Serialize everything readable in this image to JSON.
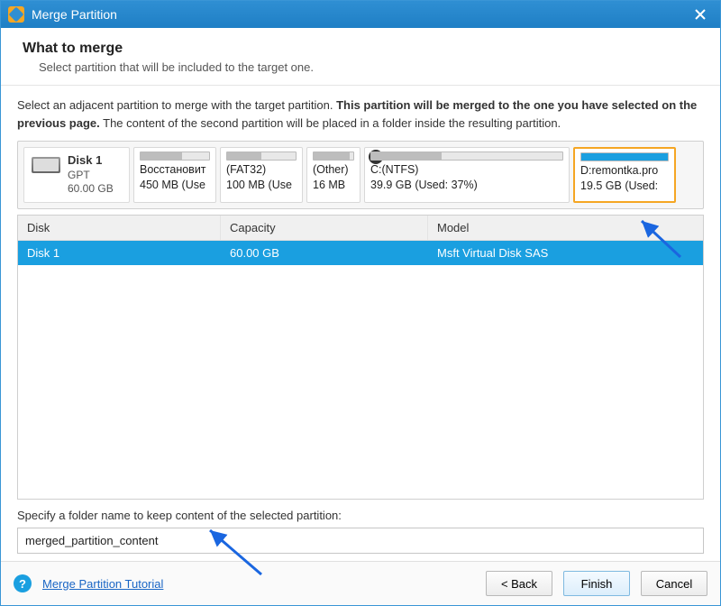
{
  "titlebar": {
    "title": "Merge Partition"
  },
  "header": {
    "heading": "What to merge",
    "sub": "Select partition that will be included to the target one."
  },
  "body": {
    "desc_pre": "Select an adjacent partition to merge with the target partition. ",
    "desc_bold": "This partition will be merged to the one you have selected on the previous page.",
    "desc_post": " The content of the second partition will be placed in a folder inside the resulting partition."
  },
  "disk": {
    "name": "Disk 1",
    "scheme": "GPT",
    "size": "60.00 GB",
    "partitions": [
      {
        "line1": "Восстановит",
        "line2": "450 MB (Use"
      },
      {
        "line1": "(FAT32)",
        "line2": "100 MB (Use"
      },
      {
        "line1": "(Other)",
        "line2": "16 MB"
      },
      {
        "line1": "C:(NTFS)",
        "line2": "39.9 GB (Used: 37%)",
        "checked": true
      },
      {
        "line1": "D:remontka.pro",
        "line2": "19.5 GB (Used:",
        "selected": true
      }
    ]
  },
  "table": {
    "headers": {
      "disk": "Disk",
      "capacity": "Capacity",
      "model": "Model"
    },
    "rows": [
      {
        "disk": "Disk 1",
        "capacity": "60.00 GB",
        "model": "Msft Virtual Disk SAS",
        "selected": true
      }
    ]
  },
  "folder": {
    "label": "Specify a folder name to keep content of the selected partition:",
    "value": "merged_partition_content"
  },
  "footer": {
    "tutorial": "Merge Partition Tutorial",
    "back": "< Back",
    "finish": "Finish",
    "cancel": "Cancel"
  }
}
